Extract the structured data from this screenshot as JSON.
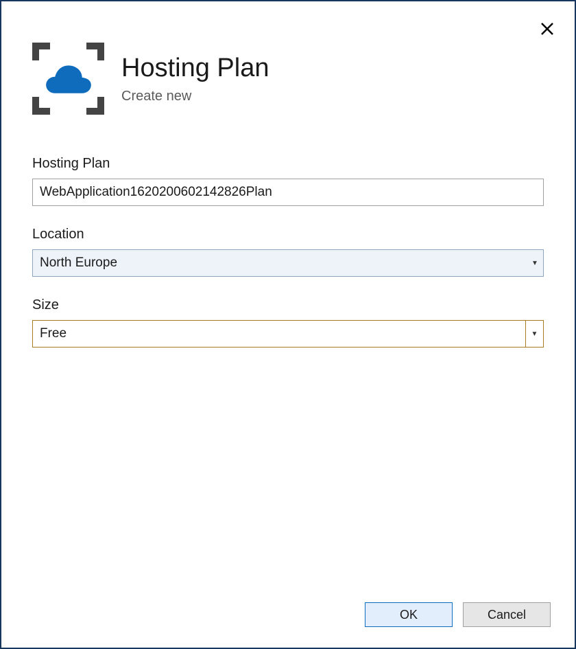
{
  "header": {
    "title": "Hosting Plan",
    "subtitle": "Create new"
  },
  "fields": {
    "hosting_plan": {
      "label": "Hosting Plan",
      "value": "WebApplication1620200602142826Plan"
    },
    "location": {
      "label": "Location",
      "selected": "North Europe"
    },
    "size": {
      "label": "Size",
      "selected": "Free"
    }
  },
  "buttons": {
    "ok": "OK",
    "cancel": "Cancel"
  }
}
